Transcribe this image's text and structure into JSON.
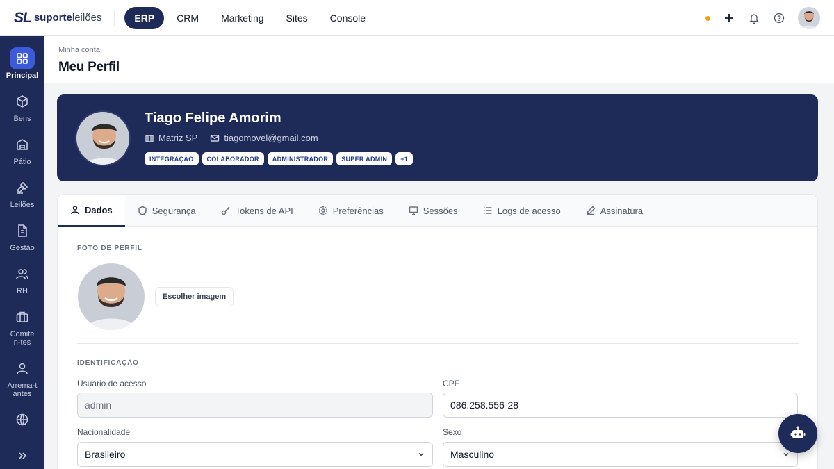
{
  "brand": {
    "mark": "SL",
    "name_bold": "suporte",
    "name_light": "leilões"
  },
  "topnav": [
    {
      "label": "ERP",
      "active": true
    },
    {
      "label": "CRM",
      "active": false
    },
    {
      "label": "Marketing",
      "active": false
    },
    {
      "label": "Sites",
      "active": false
    },
    {
      "label": "Console",
      "active": false
    }
  ],
  "sidebar": [
    {
      "label": "Principal",
      "icon": "grid-icon",
      "active": true
    },
    {
      "label": "Bens",
      "icon": "box-icon"
    },
    {
      "label": "Pátio",
      "icon": "warehouse-icon"
    },
    {
      "label": "Leilões",
      "icon": "gavel-icon"
    },
    {
      "label": "Gestão",
      "icon": "document-icon"
    },
    {
      "label": "RH",
      "icon": "users-icon"
    },
    {
      "label": "Comiten-tes",
      "icon": "briefcase-icon"
    },
    {
      "label": "Arrema-tantes",
      "icon": "user-icon"
    },
    {
      "label": "",
      "icon": "globe-icon"
    }
  ],
  "header": {
    "breadcrumb": "Minha conta",
    "title": "Meu Perfil"
  },
  "profile": {
    "name": "Tiago Felipe Amorim",
    "branch": "Matriz SP",
    "email": "tiagomovel@gmail.com",
    "roles": [
      "INTEGRAÇÃO",
      "COLABORADOR",
      "ADMINISTRADOR",
      "SUPER ADMIN",
      "+1"
    ]
  },
  "tabs": [
    {
      "label": "Dados",
      "active": true
    },
    {
      "label": "Segurança"
    },
    {
      "label": "Tokens de API"
    },
    {
      "label": "Preferências"
    },
    {
      "label": "Sessões"
    },
    {
      "label": "Logs de acesso"
    },
    {
      "label": "Assinatura"
    }
  ],
  "form": {
    "photo_section": "FOTO DE PERFIL",
    "choose_image": "Escolher imagem",
    "id_section": "IDENTIFICAÇÃO",
    "username_label": "Usuário de acesso",
    "username_value": "admin",
    "cpf_label": "CPF",
    "cpf_value": "086.258.556-28",
    "nationality_label": "Nacionalidade",
    "nationality_value": "Brasileiro",
    "sex_label": "Sexo",
    "sex_value": "Masculino"
  },
  "colors": {
    "navy": "#1e2a57",
    "accent": "#3b5bdb",
    "status_dot": "#f59e0b"
  }
}
